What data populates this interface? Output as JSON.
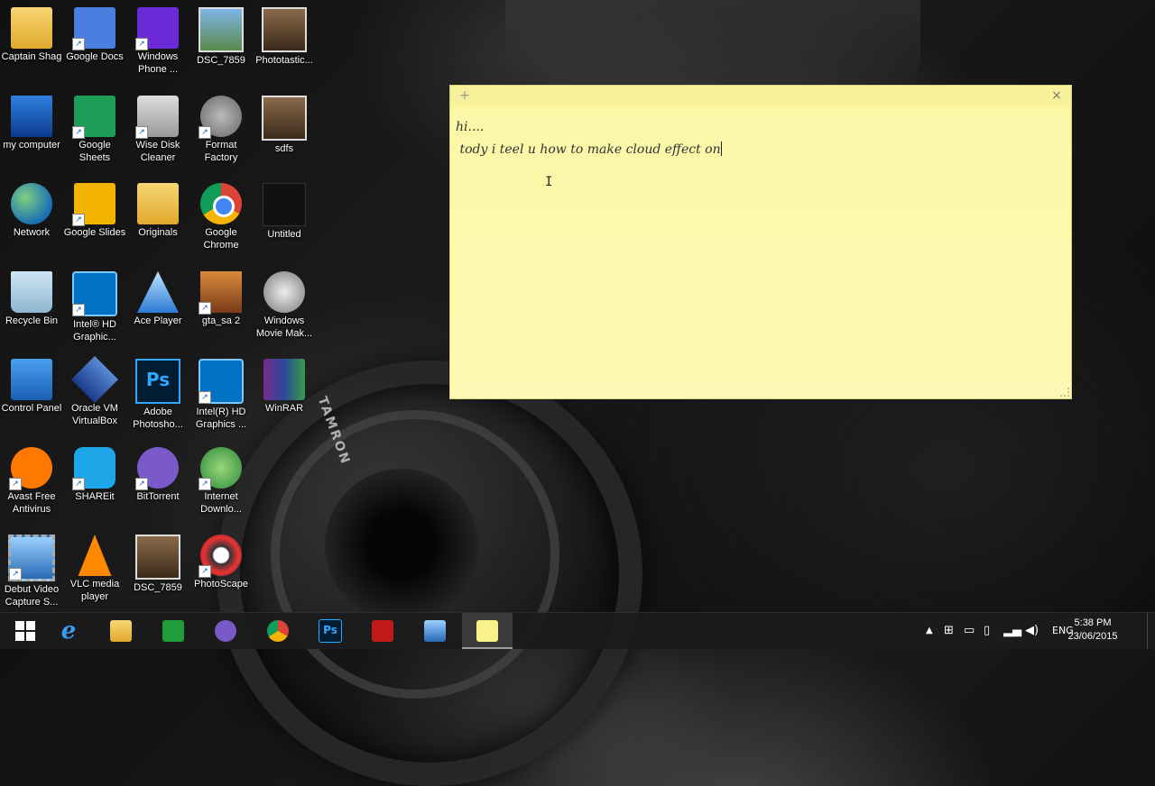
{
  "desktop": {
    "icons": [
      {
        "label": "Captain Shag"
      },
      {
        "label": "Google Docs"
      },
      {
        "label": "Windows Phone ..."
      },
      {
        "label": "DSC_7859"
      },
      {
        "label": "Phototastic..."
      },
      {
        "label": "my computer"
      },
      {
        "label": "Google Sheets"
      },
      {
        "label": "Wise Disk Cleaner"
      },
      {
        "label": "Format Factory"
      },
      {
        "label": "sdfs"
      },
      {
        "label": "Network"
      },
      {
        "label": "Google Slides"
      },
      {
        "label": "Originals"
      },
      {
        "label": "Google Chrome"
      },
      {
        "label": "Untitled"
      },
      {
        "label": "Recycle Bin"
      },
      {
        "label": "Intel® HD Graphic..."
      },
      {
        "label": "Ace Player"
      },
      {
        "label": "gta_sa 2"
      },
      {
        "label": "Windows Movie Mak..."
      },
      {
        "label": "Control Panel"
      },
      {
        "label": "Oracle VM VirtualBox"
      },
      {
        "label": "Adobe Photosho..."
      },
      {
        "label": "Intel(R) HD Graphics ..."
      },
      {
        "label": "WinRAR"
      },
      {
        "label": "Avast Free Antivirus"
      },
      {
        "label": "SHAREit"
      },
      {
        "label": "BitTorrent"
      },
      {
        "label": "Internet Downlo..."
      },
      {
        "label": "Debut Video Capture S..."
      },
      {
        "label": "VLC media player"
      },
      {
        "label": "DSC_7859"
      },
      {
        "label": "PhotoScape"
      }
    ],
    "lens_text": "TAMRON"
  },
  "sticky_note": {
    "add_icon": "+",
    "close_icon": "×",
    "line1": "hi....",
    "line2": " tody i teel u how to make cloud effect on"
  },
  "taskbar": {
    "ps_label": "Ps",
    "tray": {
      "language": "ENG",
      "time": "5:38 PM",
      "date": "23/06/2015"
    }
  }
}
